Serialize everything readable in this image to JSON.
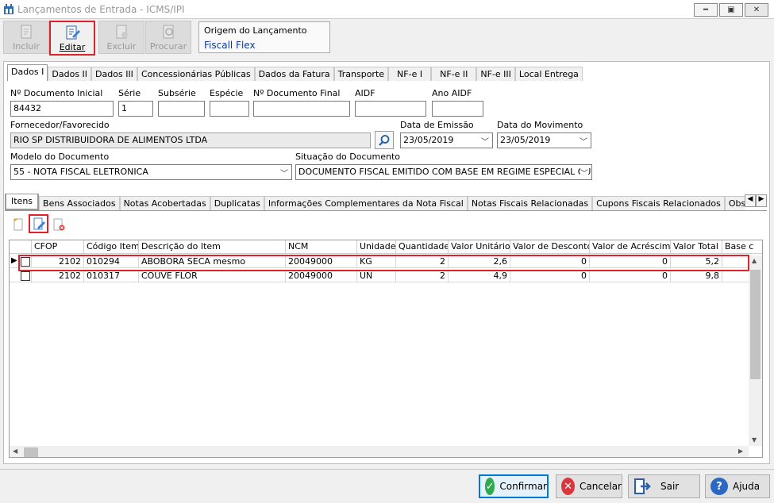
{
  "window": {
    "title": "Lançamentos de Entrada - ICMS/IPI"
  },
  "toolbar": {
    "incluir": "Incluir",
    "editar": "Editar",
    "excluir": "Excluir",
    "procurar": "Procurar"
  },
  "origem": {
    "label": "Origem do Lançamento",
    "value": "Fiscall Flex"
  },
  "tabs": [
    "Dados I",
    "Dados II",
    "Dados III",
    "Concessionárias Públicas",
    "Dados da Fatura",
    "Transporte",
    "NF-e I",
    "NF-e II",
    "NF-e III",
    "Local Entrega"
  ],
  "form": {
    "num_doc_inicial": {
      "label": "Nº Documento Inicial",
      "value": "84432"
    },
    "serie": {
      "label": "Série",
      "value": "1"
    },
    "subserie": {
      "label": "Subsérie",
      "value": ""
    },
    "especie": {
      "label": "Espécie",
      "value": ""
    },
    "num_doc_final": {
      "label": "Nº Documento Final",
      "value": ""
    },
    "aidf": {
      "label": "AIDF",
      "value": ""
    },
    "ano_aidf": {
      "label": "Ano AIDF",
      "value": ""
    },
    "fornecedor": {
      "label": "Fornecedor/Favorecido",
      "value": "RIO SP DISTRIBUIDORA DE ALIMENTOS LTDA"
    },
    "data_emissao": {
      "label": "Data de Emissão",
      "value": "23/05/2019"
    },
    "data_movimento": {
      "label": "Data do Movimento",
      "value": "23/05/2019"
    },
    "modelo": {
      "label": "Modelo do Documento",
      "value": "55 - NOTA FISCAL ELETRONICA"
    },
    "situacao": {
      "label": "Situação do Documento",
      "value": "DOCUMENTO FISCAL EMITIDO COM BASE EM REGIME ESPECIAL OU"
    }
  },
  "subtabs": [
    "Itens",
    "Bens Associados",
    "Notas Acobertadas",
    "Duplicatas",
    "Informações Complementares da Nota Fiscal",
    "Notas Fiscais Relacionadas",
    "Cupons Fiscais Relacionados",
    "Observaçã"
  ],
  "grid": {
    "columns": [
      "CFOP",
      "Código Item",
      "Descrição do Item",
      "NCM",
      "Unidade",
      "Quantidade",
      "Valor Unitário",
      "Valor de Desconto",
      "Valor de Acréscimo",
      "Valor Total",
      "Base c"
    ],
    "rows": [
      [
        "2102",
        "010294",
        "ABOBORA SECA mesmo",
        "20049000",
        "KG",
        "2",
        "2,6",
        "0",
        "0",
        "5,2"
      ],
      [
        "2102",
        "010317",
        "COUVE FLOR",
        "20049000",
        "UN",
        "2",
        "4,9",
        "0",
        "0",
        "9,8"
      ]
    ]
  },
  "buttons": {
    "confirmar": "Confirmar",
    "cancelar": "Cancelar",
    "sair": "Sair",
    "ajuda": "Ajuda"
  }
}
